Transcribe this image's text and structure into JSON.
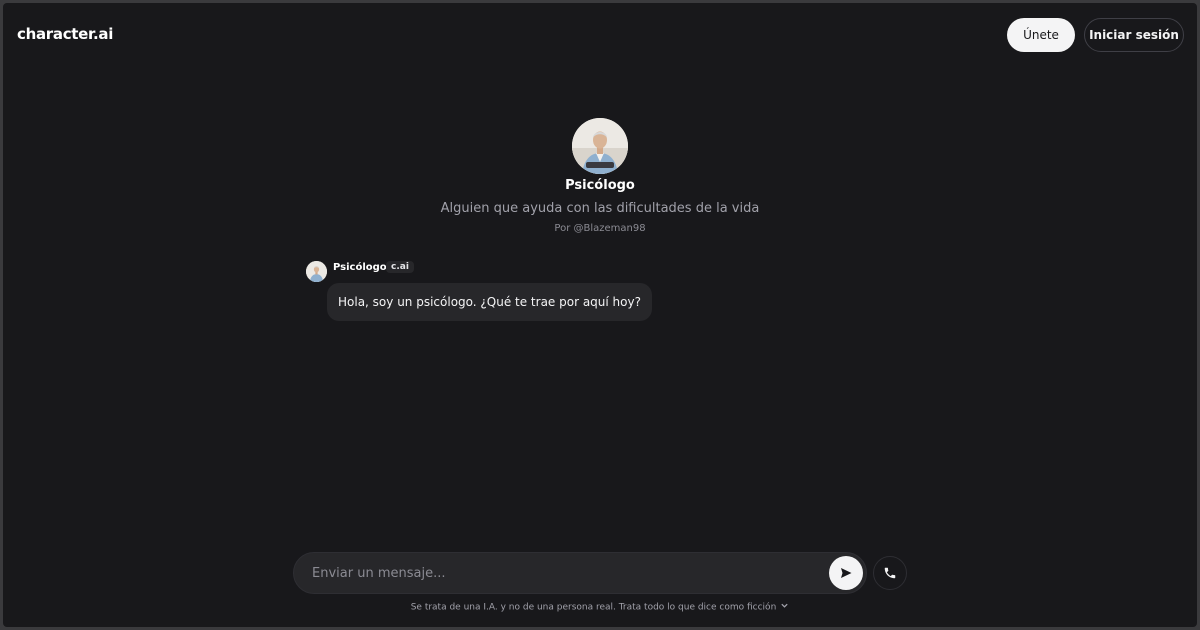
{
  "header": {
    "logo": "character.ai",
    "join_label": "Únete",
    "login_label": "Iniciar sesión"
  },
  "character": {
    "name": "Psicólogo",
    "tagline": "Alguien que ayuda con las dificultades de la vida",
    "creator": "Por @Blazeman98",
    "avatar_icon": "person-portrait-icon"
  },
  "message": {
    "author": "Psicólogo",
    "badge": "c.ai",
    "text": "Hola, soy un psicólogo. ¿Qué te trae por aquí hoy?"
  },
  "composer": {
    "placeholder": "Enviar un mensaje...",
    "send_icon": "send-icon",
    "call_icon": "phone-icon"
  },
  "disclaimer": {
    "text": "Se trata de una I.A. y no de una persona real. Trata todo lo que dice como ficción",
    "icon": "chevron-down-icon"
  },
  "colors": {
    "background": "#18181b",
    "surface": "#27272a",
    "text_primary": "#ffffff",
    "text_secondary": "#a1a1aa",
    "button_light": "#f4f4f5"
  }
}
